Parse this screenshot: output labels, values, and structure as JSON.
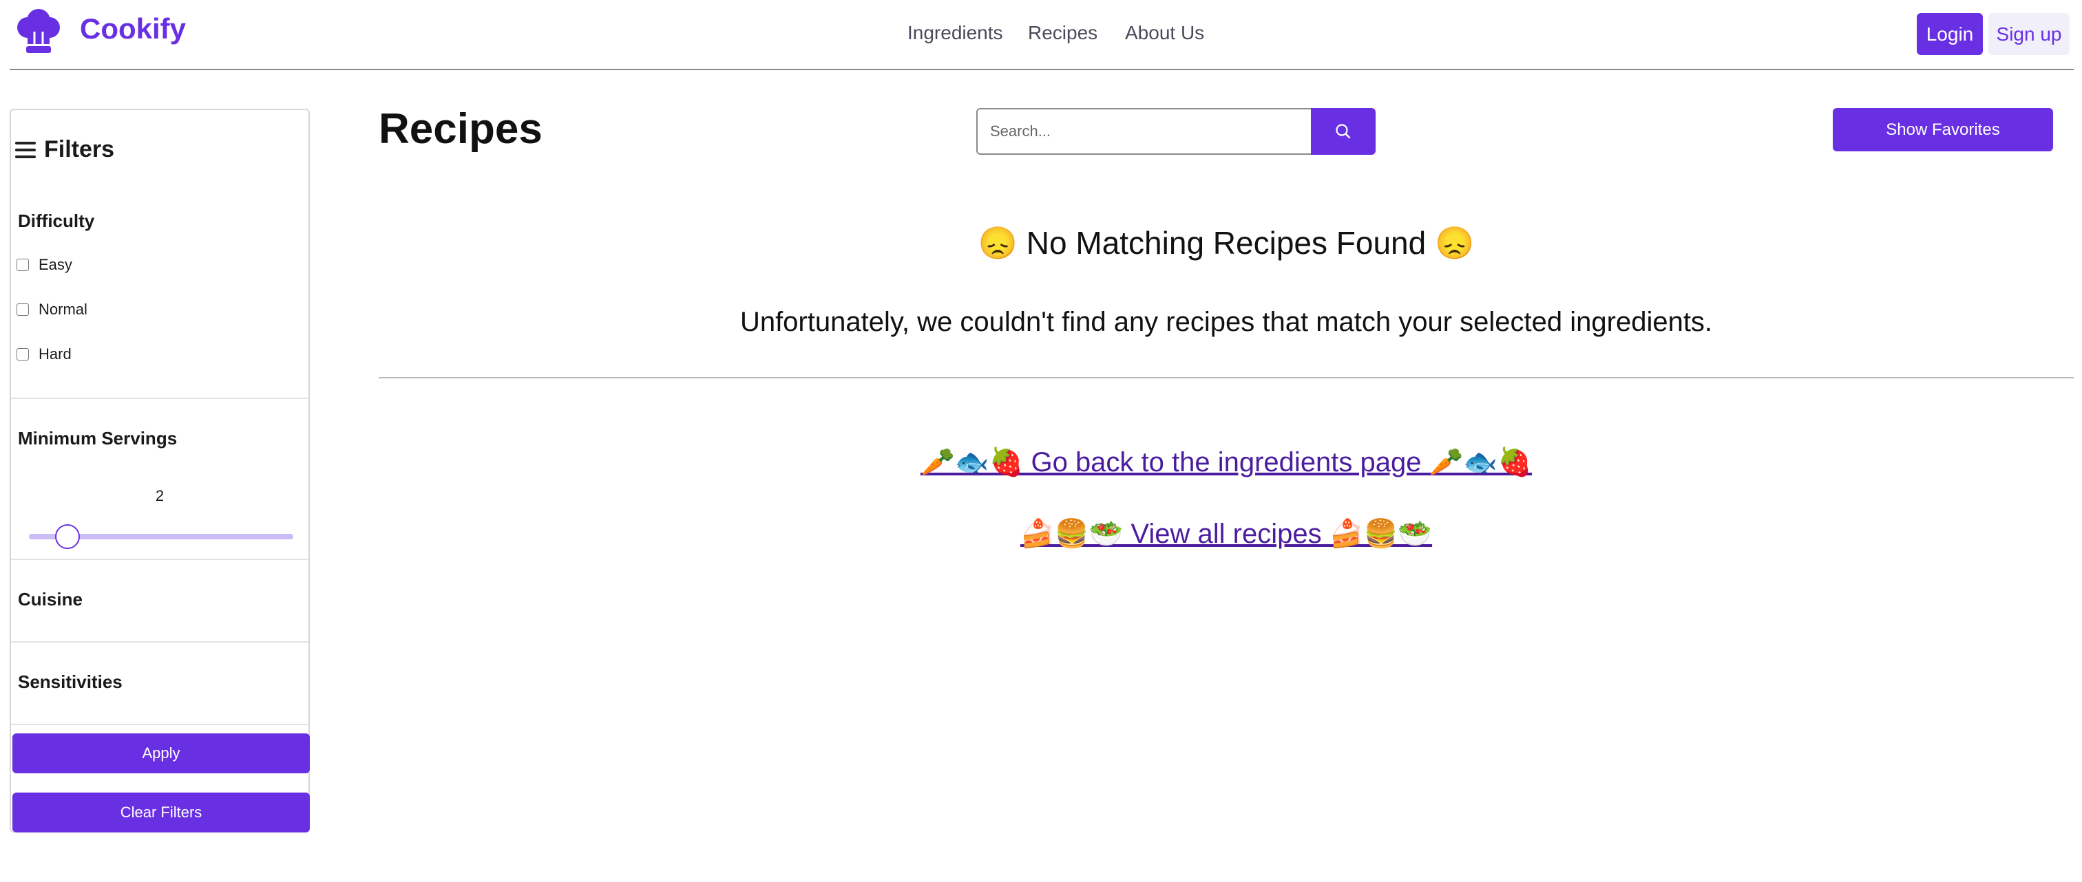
{
  "header": {
    "brand": "Cookify",
    "nav": [
      "Ingredients",
      "Recipes",
      "About Us"
    ],
    "login_label": "Login",
    "signup_label": "Sign up"
  },
  "sidebar": {
    "title": "Filters",
    "difficulty": {
      "title": "Difficulty",
      "options": [
        "Easy",
        "Normal",
        "Hard"
      ]
    },
    "servings": {
      "title": "Minimum Servings",
      "value": "2"
    },
    "cuisine_title": "Cuisine",
    "sensitivities_title": "Sensitivities",
    "apply_label": "Apply",
    "clear_label": "Clear Filters"
  },
  "main": {
    "title": "Recipes",
    "search_placeholder": "Search...",
    "favorites_label": "Show Favorites",
    "no_results_title": "😞 No Matching Recipes Found 😞",
    "no_results_text": "Unfortunately, we couldn't find any recipes that match your selected ingredients.",
    "back_link": "🥕🐟🍓 Go back to the ingredients page 🥕🐟🍓",
    "all_link": "🍰🍔🥗 View all recipes 🍰🍔🥗"
  },
  "colors": {
    "accent": "#6930e3",
    "link": "#4b1d9e",
    "slider_track": "#cbbdf6"
  },
  "icons": [
    "chef-hat-icon",
    "menu-icon",
    "search-icon"
  ]
}
